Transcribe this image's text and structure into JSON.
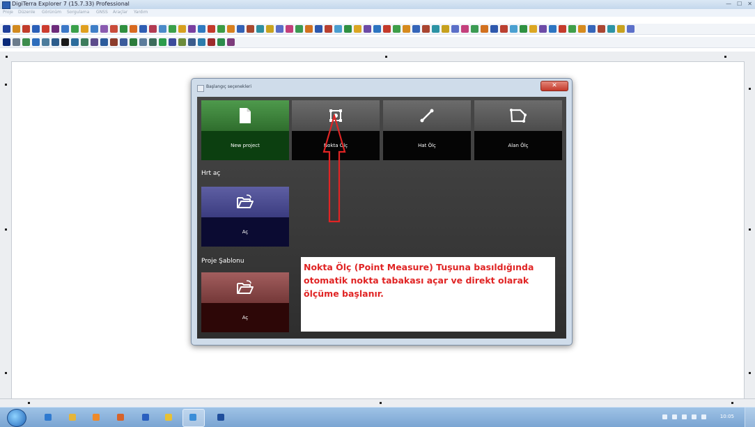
{
  "window": {
    "title": "DigiTerra Explorer 7 (15.7.33) Professional",
    "buttons": [
      "—",
      "☐",
      "✕"
    ]
  },
  "menu": [
    "Proje",
    "Düzenle",
    "Görünüm",
    "Sorgulama",
    "GNSS",
    "Araçlar",
    "Yardım"
  ],
  "toolbar_row1_colors": [
    "#1f3f9a",
    "#d28a1f",
    "#c13c2b",
    "#2a5fb8",
    "#cc3c2f",
    "#6c2a7a",
    "#3c78c7",
    "#3aa04a",
    "#e0a020",
    "#3f7ec7",
    "#8a5bb0",
    "#c94b3a",
    "#2f8f3f",
    "#d86a20",
    "#2e5db3",
    "#b23a52",
    "#4a8ac9",
    "#3aa04a",
    "#d7a020",
    "#7a3fa0",
    "#2f7ac0",
    "#c43a2b",
    "#3c9c45",
    "#d8801f",
    "#3462b5",
    "#a8482f",
    "#2e8fa0",
    "#c9a31f",
    "#5a6ec7",
    "#c33f7b",
    "#3b9a52",
    "#d2711f",
    "#2d58ad",
    "#b94030",
    "#4a9ed0",
    "#2f9040",
    "#dba622",
    "#6c4aa6",
    "#2c74c1",
    "#c43a2b",
    "#3e9e48",
    "#d68a1e",
    "#3565b9",
    "#a94531",
    "#2c93a4",
    "#c7a11e",
    "#5b6fc8",
    "#c4407c",
    "#3c9b53",
    "#d2711f",
    "#2e58ad",
    "#bb4031",
    "#4aa0d1",
    "#2f9141",
    "#dca722",
    "#6d4ba7",
    "#2d75c2",
    "#c53b2c",
    "#3f9f49",
    "#d78b1f",
    "#3666ba",
    "#aa4632",
    "#2d94a5",
    "#c8a21f",
    "#5c70c9"
  ],
  "toolbar_row2_colors": [
    "#0a2a7a",
    "#6c7c8c",
    "#3c8c4c",
    "#2c6cbc",
    "#4c7c9c",
    "#2c5c8c",
    "#1a1a1a",
    "#2c6c9c",
    "#3c7c5c",
    "#5c4c8c",
    "#2c5c9c",
    "#8c3c2c",
    "#3c5c9c",
    "#2c7c3c",
    "#5c7c9c",
    "#3c6c5c",
    "#2c9c4c",
    "#3c4c9c",
    "#6c8c3c",
    "#3c5c8c",
    "#2c7cac",
    "#9c2c2c",
    "#2c8c4c",
    "#7c3c7c"
  ],
  "dialog": {
    "title": "Başlangıç seçenekleri",
    "close_label": "✕",
    "tiles": [
      {
        "id": "new_project",
        "label": "New project",
        "icon": "new-file-icon"
      },
      {
        "id": "nokta_olc",
        "label": "Nokta Ölç",
        "icon": "point-measure-icon"
      },
      {
        "id": "hat_olc",
        "label": "Hat Ölç",
        "icon": "line-measure-icon"
      },
      {
        "id": "alan_olc",
        "label": "Alan Ölç",
        "icon": "area-measure-icon"
      }
    ],
    "map_section_label": "Hrt aç",
    "map_open_label": "Aç",
    "template_section_label": "Proje Şablonu",
    "template_open_label": "Aç"
  },
  "annotation": {
    "text": "Nokta Ölç (Point Measure) Tuşuna basıldığında otomatik nokta tabakası açar ve direkt olarak ölçüme başlanır.",
    "color": "#e02424"
  },
  "taskbar": {
    "clock": "10:05",
    "app_icons": [
      "ie-icon",
      "explorer-icon",
      "media-icon",
      "firefox-icon",
      "word-icon",
      "chrome-icon",
      "paint-icon",
      "digiterra-icon"
    ]
  }
}
